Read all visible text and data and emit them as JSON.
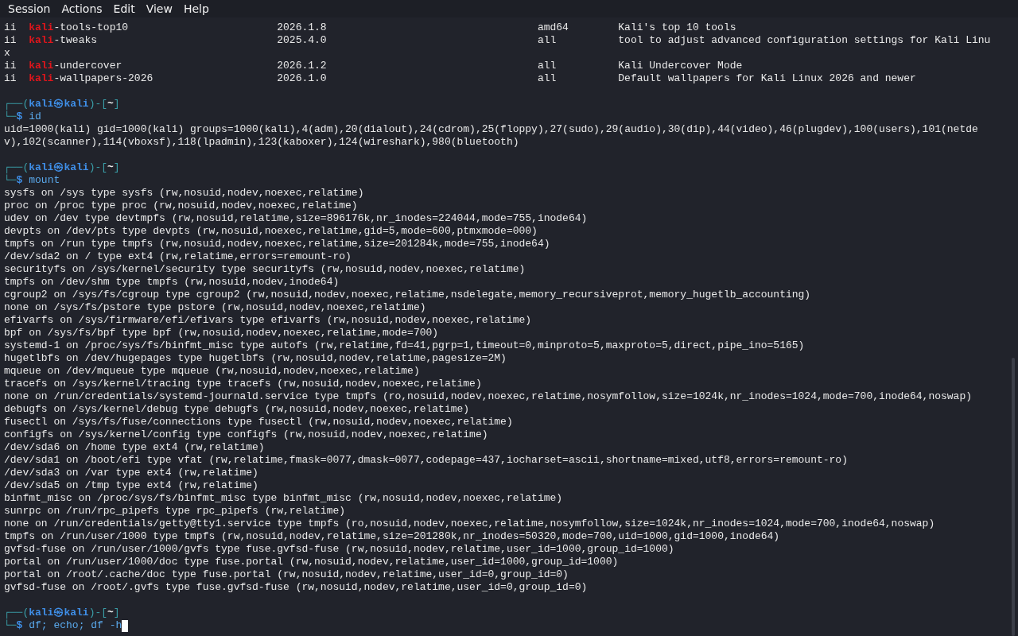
{
  "menu": [
    "Session",
    "Actions",
    "Edit",
    "View",
    "Help"
  ],
  "lines": [
    {
      "kind": "package",
      "status": "ii",
      "match": "kali",
      "rest": "-tools-top10",
      "version": "2026.1.8",
      "arch": "amd64",
      "description": "Kali's top 10 tools"
    },
    {
      "kind": "package",
      "status": "ii",
      "match": "kali",
      "rest": "-tweaks",
      "version": "2025.4.0",
      "arch": "all",
      "description": "tool to adjust advanced configuration settings for Kali Linu"
    },
    {
      "kind": "text",
      "text": "x"
    },
    {
      "kind": "package",
      "status": "ii",
      "match": "kali",
      "rest": "-undercover",
      "version": "2026.1.2",
      "arch": "all",
      "description": "Kali Undercover Mode"
    },
    {
      "kind": "package",
      "status": "ii",
      "match": "kali",
      "rest": "-wallpapers-2026",
      "version": "2026.1.0",
      "arch": "all",
      "description": "Default wallpapers for Kali Linux 2026 and newer"
    },
    {
      "kind": "blank"
    },
    {
      "kind": "prompt",
      "frame_top": "┌──(",
      "user": "kali",
      "separator": "㉿",
      "host": "kali",
      "path_open": ")-[",
      "dir": "~",
      "path_close": "]",
      "frame_bottom": "└─",
      "symbol": "$",
      "command": "id",
      "cursor": false
    },
    {
      "kind": "text",
      "text": "uid=1000(kali) gid=1000(kali) groups=1000(kali),4(adm),20(dialout),24(cdrom),25(floppy),27(sudo),29(audio),30(dip),44(video),46(plugdev),100(users),101(netde"
    },
    {
      "kind": "text",
      "text": "v),102(scanner),114(vboxsf),118(lpadmin),123(kaboxer),124(wireshark),980(bluetooth)"
    },
    {
      "kind": "blank"
    },
    {
      "kind": "prompt",
      "frame_top": "┌──(",
      "user": "kali",
      "separator": "㉿",
      "host": "kali",
      "path_open": ")-[",
      "dir": "~",
      "path_close": "]",
      "frame_bottom": "└─",
      "symbol": "$",
      "command": "mount",
      "cursor": false
    },
    {
      "kind": "text",
      "text": "sysfs on /sys type sysfs (rw,nosuid,nodev,noexec,relatime)"
    },
    {
      "kind": "text",
      "text": "proc on /proc type proc (rw,nosuid,nodev,noexec,relatime)"
    },
    {
      "kind": "text",
      "text": "udev on /dev type devtmpfs (rw,nosuid,relatime,size=896176k,nr_inodes=224044,mode=755,inode64)"
    },
    {
      "kind": "text",
      "text": "devpts on /dev/pts type devpts (rw,nosuid,noexec,relatime,gid=5,mode=600,ptmxmode=000)"
    },
    {
      "kind": "text",
      "text": "tmpfs on /run type tmpfs (rw,nosuid,nodev,noexec,relatime,size=201284k,mode=755,inode64)"
    },
    {
      "kind": "text",
      "text": "/dev/sda2 on / type ext4 (rw,relatime,errors=remount-ro)"
    },
    {
      "kind": "text",
      "text": "securityfs on /sys/kernel/security type securityfs (rw,nosuid,nodev,noexec,relatime)"
    },
    {
      "kind": "text",
      "text": "tmpfs on /dev/shm type tmpfs (rw,nosuid,nodev,inode64)"
    },
    {
      "kind": "text",
      "text": "cgroup2 on /sys/fs/cgroup type cgroup2 (rw,nosuid,nodev,noexec,relatime,nsdelegate,memory_recursiveprot,memory_hugetlb_accounting)"
    },
    {
      "kind": "text",
      "text": "none on /sys/fs/pstore type pstore (rw,nosuid,nodev,noexec,relatime)"
    },
    {
      "kind": "text",
      "text": "efivarfs on /sys/firmware/efi/efivars type efivarfs (rw,nosuid,nodev,noexec,relatime)"
    },
    {
      "kind": "text",
      "text": "bpf on /sys/fs/bpf type bpf (rw,nosuid,nodev,noexec,relatime,mode=700)"
    },
    {
      "kind": "text",
      "text": "systemd-1 on /proc/sys/fs/binfmt_misc type autofs (rw,relatime,fd=41,pgrp=1,timeout=0,minproto=5,maxproto=5,direct,pipe_ino=5165)"
    },
    {
      "kind": "text",
      "text": "hugetlbfs on /dev/hugepages type hugetlbfs (rw,nosuid,nodev,relatime,pagesize=2M)"
    },
    {
      "kind": "text",
      "text": "mqueue on /dev/mqueue type mqueue (rw,nosuid,nodev,noexec,relatime)"
    },
    {
      "kind": "text",
      "text": "tracefs on /sys/kernel/tracing type tracefs (rw,nosuid,nodev,noexec,relatime)"
    },
    {
      "kind": "text",
      "text": "none on /run/credentials/systemd-journald.service type tmpfs (ro,nosuid,nodev,noexec,relatime,nosymfollow,size=1024k,nr_inodes=1024,mode=700,inode64,noswap)"
    },
    {
      "kind": "text",
      "text": "debugfs on /sys/kernel/debug type debugfs (rw,nosuid,nodev,noexec,relatime)"
    },
    {
      "kind": "text",
      "text": "fusectl on /sys/fs/fuse/connections type fusectl (rw,nosuid,nodev,noexec,relatime)"
    },
    {
      "kind": "text",
      "text": "configfs on /sys/kernel/config type configfs (rw,nosuid,nodev,noexec,relatime)"
    },
    {
      "kind": "text",
      "text": "/dev/sda6 on /home type ext4 (rw,relatime)"
    },
    {
      "kind": "text",
      "text": "/dev/sda1 on /boot/efi type vfat (rw,relatime,fmask=0077,dmask=0077,codepage=437,iocharset=ascii,shortname=mixed,utf8,errors=remount-ro)"
    },
    {
      "kind": "text",
      "text": "/dev/sda3 on /var type ext4 (rw,relatime)"
    },
    {
      "kind": "text",
      "text": "/dev/sda5 on /tmp type ext4 (rw,relatime)"
    },
    {
      "kind": "text",
      "text": "binfmt_misc on /proc/sys/fs/binfmt_misc type binfmt_misc (rw,nosuid,nodev,noexec,relatime)"
    },
    {
      "kind": "text",
      "text": "sunrpc on /run/rpc_pipefs type rpc_pipefs (rw,relatime)"
    },
    {
      "kind": "text",
      "text": "none on /run/credentials/getty@tty1.service type tmpfs (ro,nosuid,nodev,noexec,relatime,nosymfollow,size=1024k,nr_inodes=1024,mode=700,inode64,noswap)"
    },
    {
      "kind": "text",
      "text": "tmpfs on /run/user/1000 type tmpfs (rw,nosuid,nodev,relatime,size=201280k,nr_inodes=50320,mode=700,uid=1000,gid=1000,inode64)"
    },
    {
      "kind": "text",
      "text": "gvfsd-fuse on /run/user/1000/gvfs type fuse.gvfsd-fuse (rw,nosuid,nodev,relatime,user_id=1000,group_id=1000)"
    },
    {
      "kind": "text",
      "text": "portal on /run/user/1000/doc type fuse.portal (rw,nosuid,nodev,relatime,user_id=1000,group_id=1000)"
    },
    {
      "kind": "text",
      "text": "portal on /root/.cache/doc type fuse.portal (rw,nosuid,nodev,relatime,user_id=0,group_id=0)"
    },
    {
      "kind": "text",
      "text": "gvfsd-fuse on /root/.gvfs type fuse.gvfsd-fuse (rw,nosuid,nodev,relatime,user_id=0,group_id=0)"
    },
    {
      "kind": "blank"
    },
    {
      "kind": "prompt",
      "frame_top": "┌──(",
      "user": "kali",
      "separator": "㉿",
      "host": "kali",
      "path_open": ")-[",
      "dir": "~",
      "path_close": "]",
      "frame_bottom": "└─",
      "symbol": "$",
      "command": "df; echo; df -h",
      "cursor": true
    }
  ]
}
